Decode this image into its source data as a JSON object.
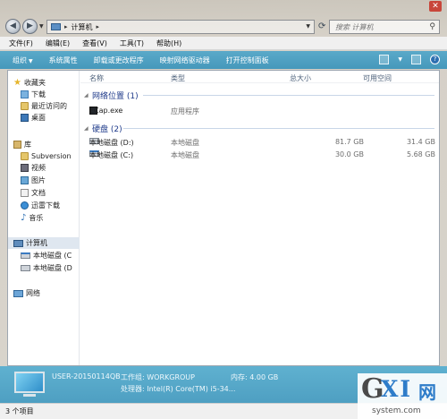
{
  "address_bar": {
    "location": "计算机",
    "search_placeholder": "搜索 计算机"
  },
  "menu": [
    "文件(F)",
    "编辑(E)",
    "查看(V)",
    "工具(T)",
    "帮助(H)"
  ],
  "toolbar": {
    "organize": "组织",
    "items": [
      "系统属性",
      "卸载或更改程序",
      "映射网络驱动器",
      "打开控制面板"
    ]
  },
  "nav": {
    "favorites": {
      "label": "收藏夹",
      "items": [
        "下载",
        "最近访问的",
        "桌面"
      ]
    },
    "libraries": {
      "label": "库",
      "items": [
        "Subversion",
        "视频",
        "图片",
        "文档",
        "迅雷下载",
        "音乐"
      ]
    },
    "computer": {
      "label": "计算机",
      "items": [
        "本地磁盘 (C",
        "本地磁盘 (D"
      ]
    },
    "network": {
      "label": "网络"
    }
  },
  "columns": {
    "name": "名称",
    "type": "类型",
    "total": "总大小",
    "free": "可用空间"
  },
  "groups": {
    "network_locations": {
      "title": "网络位置 (1)",
      "items": [
        {
          "name": "ECap.exe",
          "type": "应用程序"
        }
      ]
    },
    "hard_disks": {
      "title": "硬盘 (2)",
      "items": [
        {
          "name": "本地磁盘 (D:)",
          "type": "本地磁盘",
          "total": "81.7 GB",
          "free": "31.4 GB"
        },
        {
          "name": "本地磁盘 (C:)",
          "type": "本地磁盘",
          "total": "30.0 GB",
          "free": "5.68 GB"
        }
      ]
    }
  },
  "details": {
    "computer_name": "USER-20150114QB",
    "workgroup": "工作组: WORKGROUP",
    "memory": "内存: 4.00 GB",
    "processor": "处理器: Intel(R) Core(TM) i5-34..."
  },
  "status": "3 个项目",
  "watermark": {
    "logo_g": "G",
    "logo_xi": "XI",
    "logo_net": "网",
    "url": "system.com"
  }
}
